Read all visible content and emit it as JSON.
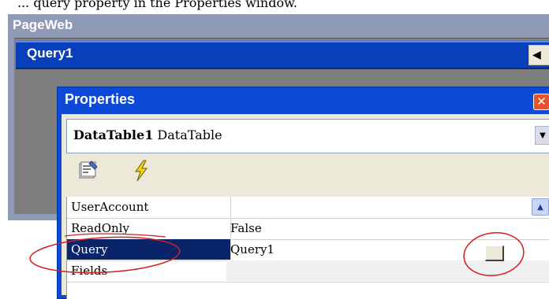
{
  "top_text": "... query property in the Properties window.",
  "pageweb": {
    "title": "PageWeb"
  },
  "query_bar": {
    "title": "Query1"
  },
  "properties": {
    "title": "Properties",
    "object_name": "DataTable1",
    "object_type": "DataTable",
    "rows": [
      {
        "name": "UserAccount",
        "value": ""
      },
      {
        "name": "ReadOnly",
        "value": "False"
      },
      {
        "name": "Query",
        "value": "Query1"
      },
      {
        "name": "Fields",
        "value": ""
      }
    ]
  },
  "annotation_color": "#d02020",
  "selection_color": "#0a246a",
  "titlebar_color": "#0b49d6"
}
